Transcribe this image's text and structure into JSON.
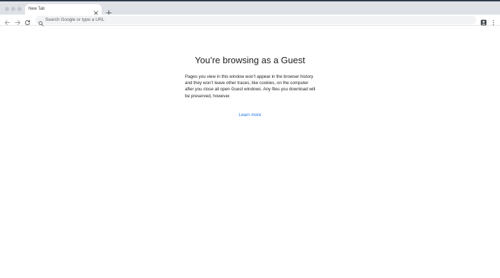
{
  "window": {
    "controls": [
      "close",
      "minimize",
      "zoom"
    ]
  },
  "tabs": [
    {
      "title": "New Tab",
      "active": true
    }
  ],
  "toolbar": {
    "back_icon": "back-arrow-icon",
    "forward_icon": "forward-arrow-icon",
    "reload_icon": "reload-icon",
    "omnibox": {
      "placeholder": "Search Google or type a URL",
      "icon": "search-icon"
    },
    "profile_icon": "guest-profile-icon",
    "menu_icon": "kebab-menu-icon"
  },
  "page": {
    "title": "You’re browsing as a Guest",
    "description": "Pages you view in this window won’t appear in the browser history and they won’t leave other traces, like cookies, on the computer after you close all open Guest windows. Any files you download will be preserved, however.",
    "learn_more": "Learn more"
  },
  "colors": {
    "tabstrip": "#dee1e6",
    "omnibox": "#f1f3f4",
    "link": "#1a73e8",
    "text": "#202124"
  }
}
